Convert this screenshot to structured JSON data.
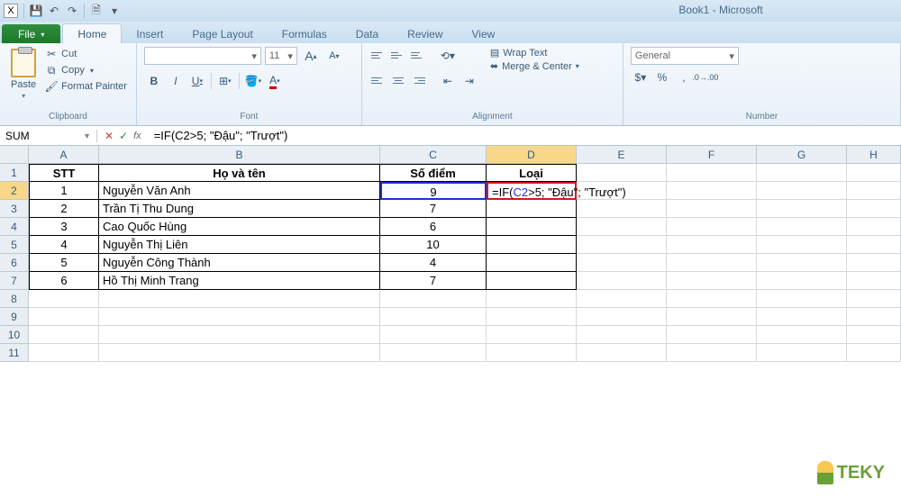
{
  "title": "Book1 - Microsoft",
  "tabs": {
    "file": "File",
    "home": "Home",
    "insert": "Insert",
    "page": "Page Layout",
    "formulas": "Formulas",
    "data": "Data",
    "review": "Review",
    "view": "View"
  },
  "clipboard": {
    "paste": "Paste",
    "cut": "Cut",
    "copy": "Copy",
    "painter": "Format Painter",
    "group": "Clipboard"
  },
  "font": {
    "size": "11",
    "group": "Font",
    "b": "B",
    "i": "I",
    "u": "U",
    "aUp": "A",
    "aDn": "A"
  },
  "alignment": {
    "wrap": "Wrap Text",
    "merge": "Merge & Center",
    "group": "Alignment"
  },
  "number": {
    "format": "General",
    "group": "Number"
  },
  "namebox": "SUM",
  "formula": "=IF(C2>5; \"Đậu\"; \"Trượt\")",
  "cellFormula": {
    "prefix": "=IF(",
    "ref": "C2",
    "rest": ">5; \"Đậu\"; \"Trượt\")"
  },
  "cols": [
    "A",
    "B",
    "C",
    "D",
    "E",
    "F",
    "G",
    "H"
  ],
  "headers": {
    "stt": "STT",
    "name": "Họ và tên",
    "score": "Số điểm",
    "type": "Loại"
  },
  "rows": [
    {
      "stt": "1",
      "name": "Nguyễn Văn Anh",
      "score": "9"
    },
    {
      "stt": "2",
      "name": "Trần Tị Thu Dung",
      "score": "7"
    },
    {
      "stt": "3",
      "name": "Cao Quốc Hùng",
      "score": "6"
    },
    {
      "stt": "4",
      "name": "Nguyễn Thị Liên",
      "score": "10"
    },
    {
      "stt": "5",
      "name": "Nguyễn Công Thành",
      "score": "4"
    },
    {
      "stt": "6",
      "name": "Hồ Thị Minh Trang",
      "score": "7"
    }
  ],
  "watermark": "TEKY"
}
